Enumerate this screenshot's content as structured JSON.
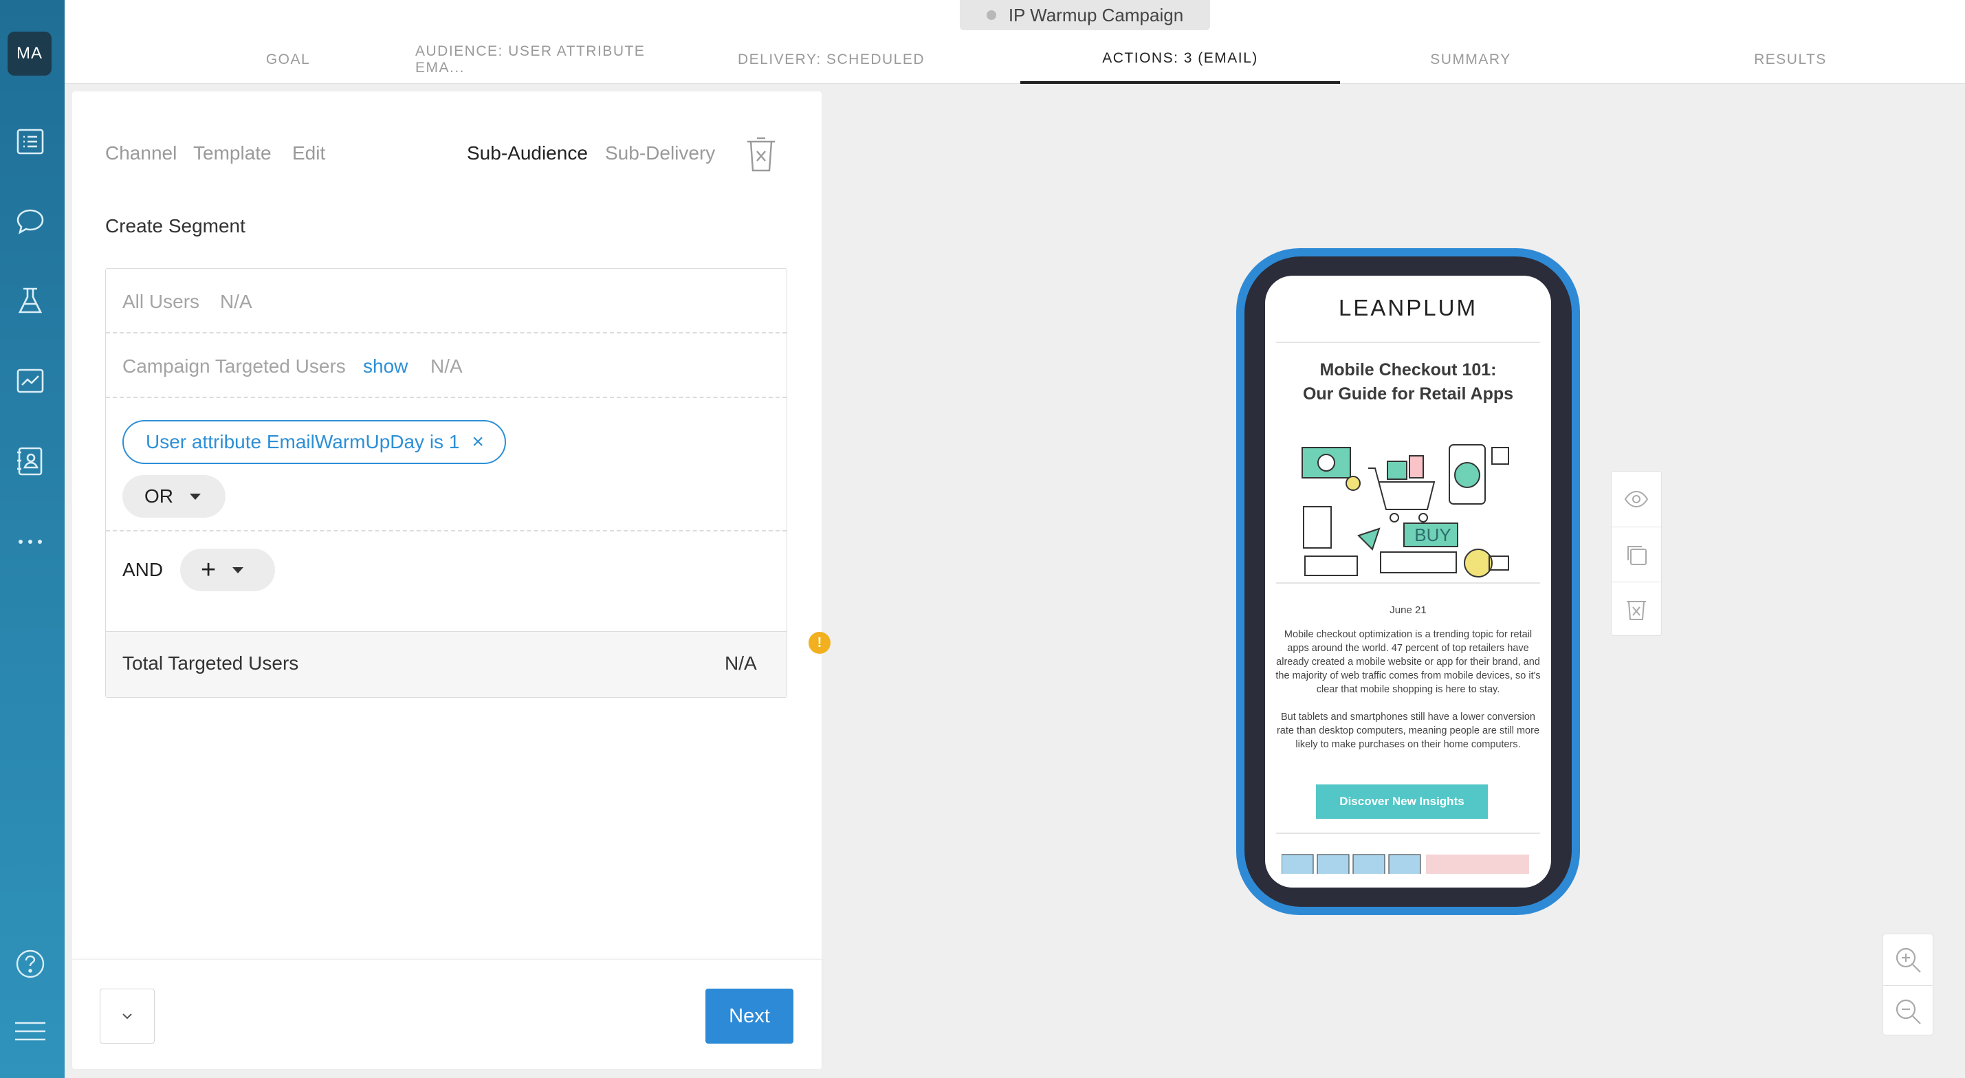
{
  "user": {
    "initials": "MA"
  },
  "campaign": {
    "name": "IP Warmup Campaign"
  },
  "tabs": [
    {
      "label": "GOAL"
    },
    {
      "label": "AUDIENCE: USER ATTRIBUTE EMA..."
    },
    {
      "label": "DELIVERY: SCHEDULED"
    },
    {
      "label": "ACTIONS: 3 (EMAIL)"
    },
    {
      "label": "SUMMARY"
    },
    {
      "label": "RESULTS"
    }
  ],
  "subnav": {
    "channel": "Channel",
    "template": "Template",
    "edit": "Edit",
    "sub_audience": "Sub-Audience",
    "sub_delivery": "Sub-Delivery"
  },
  "segment": {
    "title": "Create Segment",
    "all_users_label": "All Users",
    "all_users_value": "N/A",
    "targeted_label": "Campaign Targeted Users",
    "targeted_show": "show",
    "targeted_value": "N/A",
    "condition_chip": "User attribute EmailWarmUpDay is 1",
    "chip_remove": "×",
    "or_label": "OR",
    "and_label": "AND",
    "add_label": "+",
    "total_label": "Total Targeted Users",
    "total_value": "N/A",
    "warning_glyph": "!"
  },
  "footer": {
    "next_label": "Next"
  },
  "preview": {
    "logo": "LEANPLUM",
    "headline_line1": "Mobile Checkout 101:",
    "headline_line2": "Our Guide for Retail Apps",
    "buy_label": "BUY",
    "date": "June 21",
    "para1": "Mobile checkout optimization is a trending topic for retail apps around the world. 47 percent of top retailers have already created a mobile website or app for their brand, and the majority of web traffic comes from mobile devices, so it's clear that mobile shopping is here to stay.",
    "para2": "But tablets and smartphones still have a lower conversion rate than desktop computers, meaning people are still more likely to make purchases on their home computers.",
    "cta": "Discover New Insights"
  },
  "colors": {
    "accent": "#2c8fd6",
    "sidebar": "#2479a3",
    "cta": "#53c7c8",
    "warning": "#f2b01e",
    "phone_frame": "#2f8ad6"
  }
}
